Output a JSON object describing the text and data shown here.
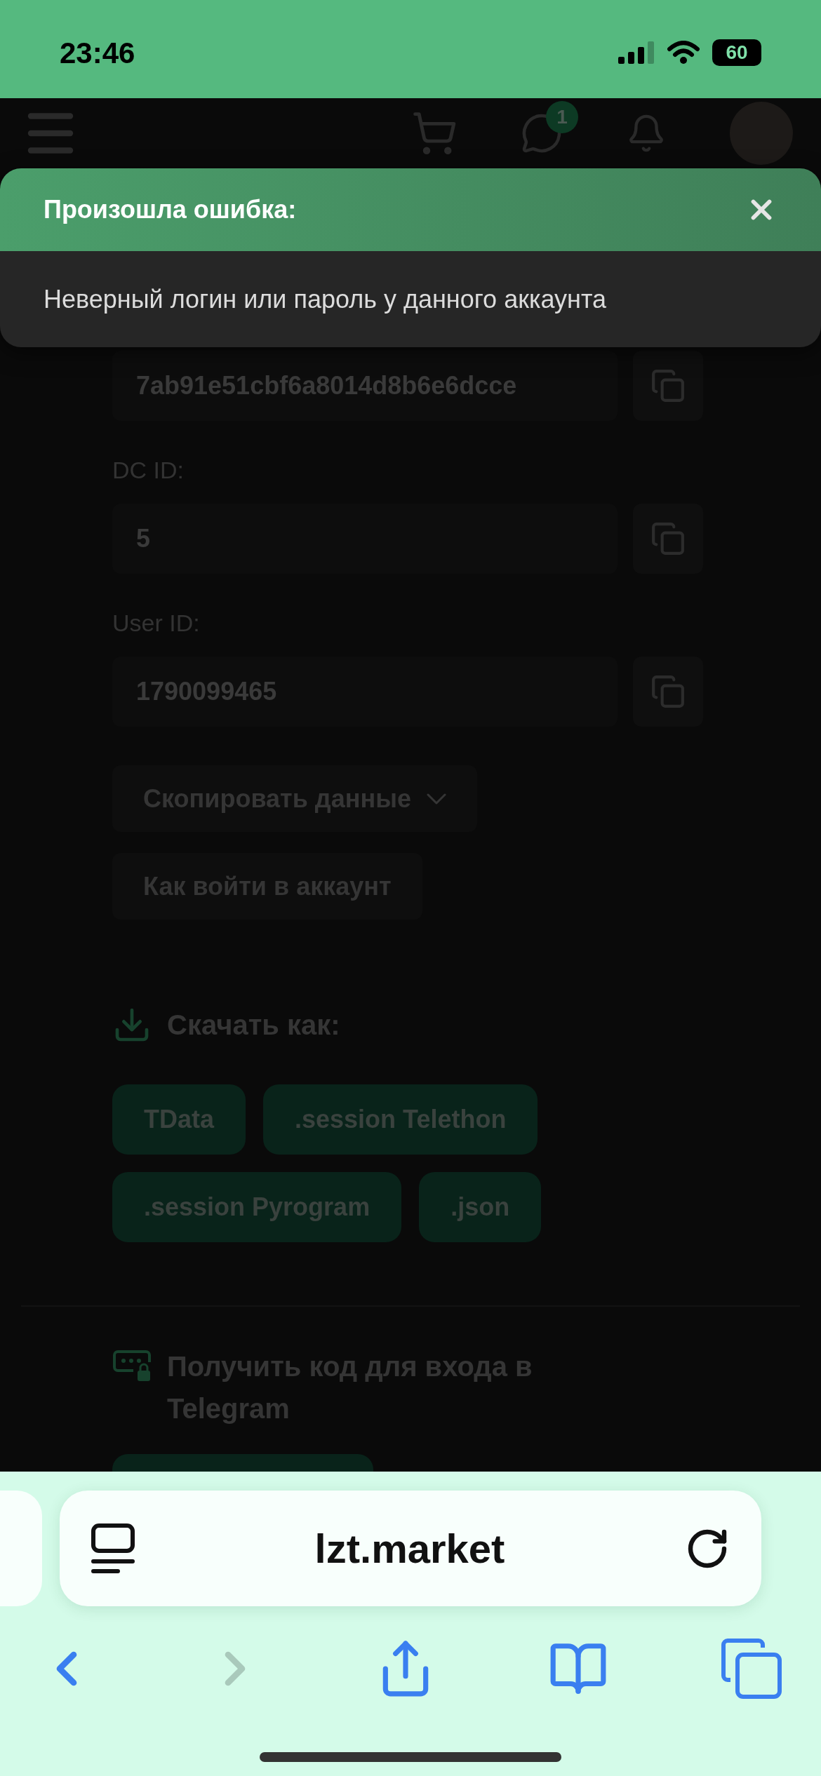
{
  "status_bar": {
    "time": "23:46",
    "battery": "60"
  },
  "header": {
    "messages_badge": "1"
  },
  "toast": {
    "title": "Произошла ошибка:",
    "message": "Неверный логин или пароль у данного аккаунта"
  },
  "fields": [
    {
      "value": "7ab91e51cbf6a8014d8b6e6dcce"
    },
    {
      "label": "DC ID:",
      "value": "5"
    },
    {
      "label": "User ID:",
      "value": "1790099465"
    }
  ],
  "actions": [
    {
      "label": "Скопировать данные",
      "kind": "dropdown"
    },
    {
      "label": "Как войти в аккаунт",
      "kind": "plain"
    }
  ],
  "download": {
    "title": "Скачать как:",
    "formats": [
      "TData",
      ".session Telethon",
      ".session Pyrogram",
      ".json"
    ]
  },
  "login_code": {
    "title": "Получить код для входа в Telegram"
  },
  "browser": {
    "url": "lzt.market",
    "forward_disabled": true
  }
}
